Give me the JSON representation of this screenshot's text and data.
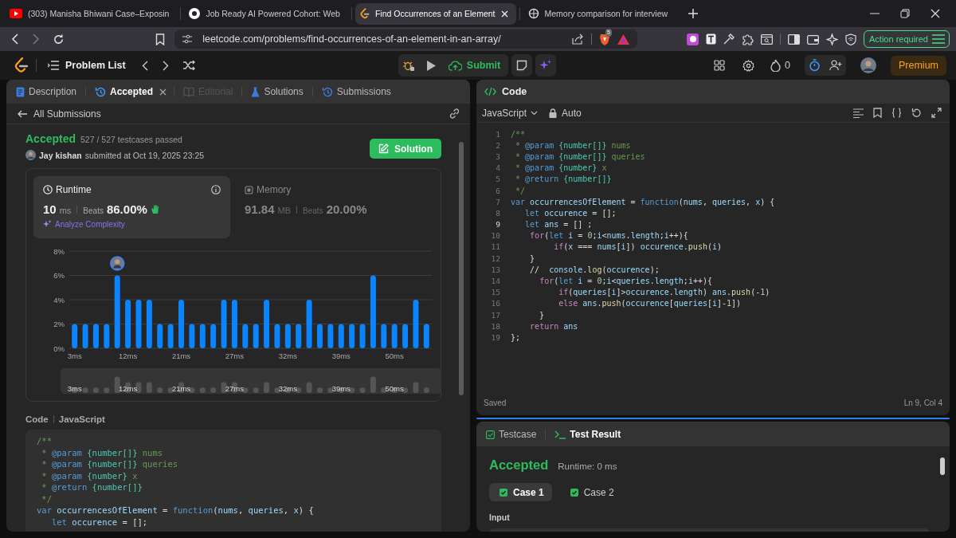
{
  "browser": {
    "tabs": [
      {
        "title": "(303) Manisha Bhiwani Case–Exposin",
        "selected": false
      },
      {
        "title": "Job Ready AI Powered Cohort: Web",
        "selected": false
      },
      {
        "title": "Find Occurrences of an Element",
        "selected": true
      },
      {
        "title": "Memory comparison for interview",
        "selected": false
      }
    ],
    "url": "leetcode.com/problems/find-occurrences-of-an-element-in-an-array/",
    "shield_badge": "5",
    "action_button": "Action required"
  },
  "nav": {
    "problem_list": "Problem List",
    "submit": "Submit",
    "streak": "0",
    "premium": "Premium"
  },
  "left_panel": {
    "tabs": [
      {
        "label": "Description",
        "selected": false,
        "disabled": false,
        "closable": false
      },
      {
        "label": "Accepted",
        "selected": true,
        "disabled": false,
        "closable": true
      },
      {
        "label": "Editorial",
        "selected": false,
        "disabled": true,
        "closable": false
      },
      {
        "label": "Solutions",
        "selected": false,
        "disabled": false,
        "closable": false
      },
      {
        "label": "Submissions",
        "selected": false,
        "disabled": false,
        "closable": false
      }
    ],
    "back_link": "All Submissions",
    "status": "Accepted",
    "testcases": "527 / 527 testcases passed",
    "author": "Jay kishan",
    "submitted": "submitted at Oct 19, 2025 23:25",
    "solution_button": "Solution",
    "metrics": [
      {
        "title": "Runtime",
        "value": "10",
        "unit": "ms",
        "beats_label": "Beats",
        "beats": "86.00%",
        "selected": true
      },
      {
        "title": "Memory",
        "value": "91.84",
        "unit": "MB",
        "beats_label": "Beats",
        "beats": "20.00%",
        "selected": false
      }
    ],
    "analyze": "Analyze Complexity",
    "chart_data": {
      "type": "bar",
      "categories": [
        "3ms",
        null,
        null,
        null,
        null,
        "12ms",
        null,
        null,
        null,
        null,
        "21ms",
        null,
        null,
        null,
        null,
        "27ms",
        null,
        null,
        null,
        null,
        "32ms",
        null,
        null,
        null,
        null,
        "39ms",
        null,
        null,
        null,
        null,
        "50ms",
        null,
        null,
        null
      ],
      "series": [
        {
          "color": "#0a84ff",
          "values": [
            2,
            2,
            2,
            2,
            6,
            4,
            4,
            4,
            2,
            2,
            4,
            2,
            2,
            2,
            4,
            4,
            2,
            2,
            4,
            2,
            2,
            2,
            4,
            2,
            2,
            2,
            2,
            2,
            6,
            2,
            2,
            2,
            4,
            2
          ]
        }
      ],
      "ylim": [
        0,
        8
      ],
      "yticks": [
        {
          "value": 0,
          "label": "0%"
        },
        {
          "value": 2,
          "label": "2%"
        },
        {
          "value": 4,
          "label": "4%"
        },
        {
          "value": 6,
          "label": "6%"
        },
        {
          "value": 8,
          "label": "8%"
        }
      ],
      "grid": true
    },
    "overview_labels": [
      "3ms",
      "12ms",
      "21ms",
      "27ms",
      "32ms",
      "39ms",
      "50ms"
    ],
    "code_title": "Code",
    "code_language": "JavaScript",
    "code_lines": [
      "/**",
      " * @param {number[]} nums",
      " * @param {number[]} queries",
      " * @param {number} x",
      " * @return {number[]}",
      " */",
      "var occurrencesOfElement = function(nums, queries, x) {",
      "   let occurence = [];"
    ]
  },
  "editor": {
    "title": "Code",
    "language": "JavaScript",
    "mode": "Auto",
    "lines": [
      {
        "number": "1",
        "text": "/**",
        "current": false
      },
      {
        "number": "2",
        "text": " * @param {number[]} nums",
        "current": false
      },
      {
        "number": "3",
        "text": " * @param {number[]} queries",
        "current": false
      },
      {
        "number": "4",
        "text": " * @param {number} x",
        "current": false
      },
      {
        "number": "5",
        "text": " * @return {number[]}",
        "current": false
      },
      {
        "number": "6",
        "text": " */",
        "current": false
      },
      {
        "number": "7",
        "text": "var occurrencesOfElement = function(nums, queries, x) {",
        "current": false
      },
      {
        "number": "8",
        "text": "   let occurence = [];",
        "current": false
      },
      {
        "number": "9",
        "text": "   let ans = [] ;",
        "current": true
      },
      {
        "number": "10",
        "text": "    for(let i = 0;i<nums.length;i++){",
        "current": false
      },
      {
        "number": "11",
        "text": "         if(x === nums[i]) occurence.push(i)",
        "current": false
      },
      {
        "number": "12",
        "text": "    }",
        "current": false
      },
      {
        "number": "13",
        "text": "    //  console.log(occurence);",
        "current": false
      },
      {
        "number": "14",
        "text": "      for(let i = 0;i<queries.length;i++){",
        "current": false
      },
      {
        "number": "15",
        "text": "          if(queries[i]>occurence.length) ans.push(-1)",
        "current": false
      },
      {
        "number": "16",
        "text": "          else ans.push(occurence[queries[i]-1])",
        "current": false
      },
      {
        "number": "17",
        "text": "      }",
        "current": false
      },
      {
        "number": "18",
        "text": "    return ans",
        "current": false
      },
      {
        "number": "19",
        "text": "};",
        "current": false
      }
    ],
    "status": "Saved",
    "position": "Ln 9, Col 4"
  },
  "test_panel": {
    "tabs": [
      {
        "label": "Testcase",
        "selected": false
      },
      {
        "label": "Test Result",
        "selected": true
      }
    ],
    "status": "Accepted",
    "runtime": "Runtime: 0 ms",
    "cases": [
      {
        "label": "Case 1",
        "selected": true,
        "passed": true
      },
      {
        "label": "Case 2",
        "selected": false,
        "passed": true
      }
    ],
    "input_label": "Input"
  }
}
